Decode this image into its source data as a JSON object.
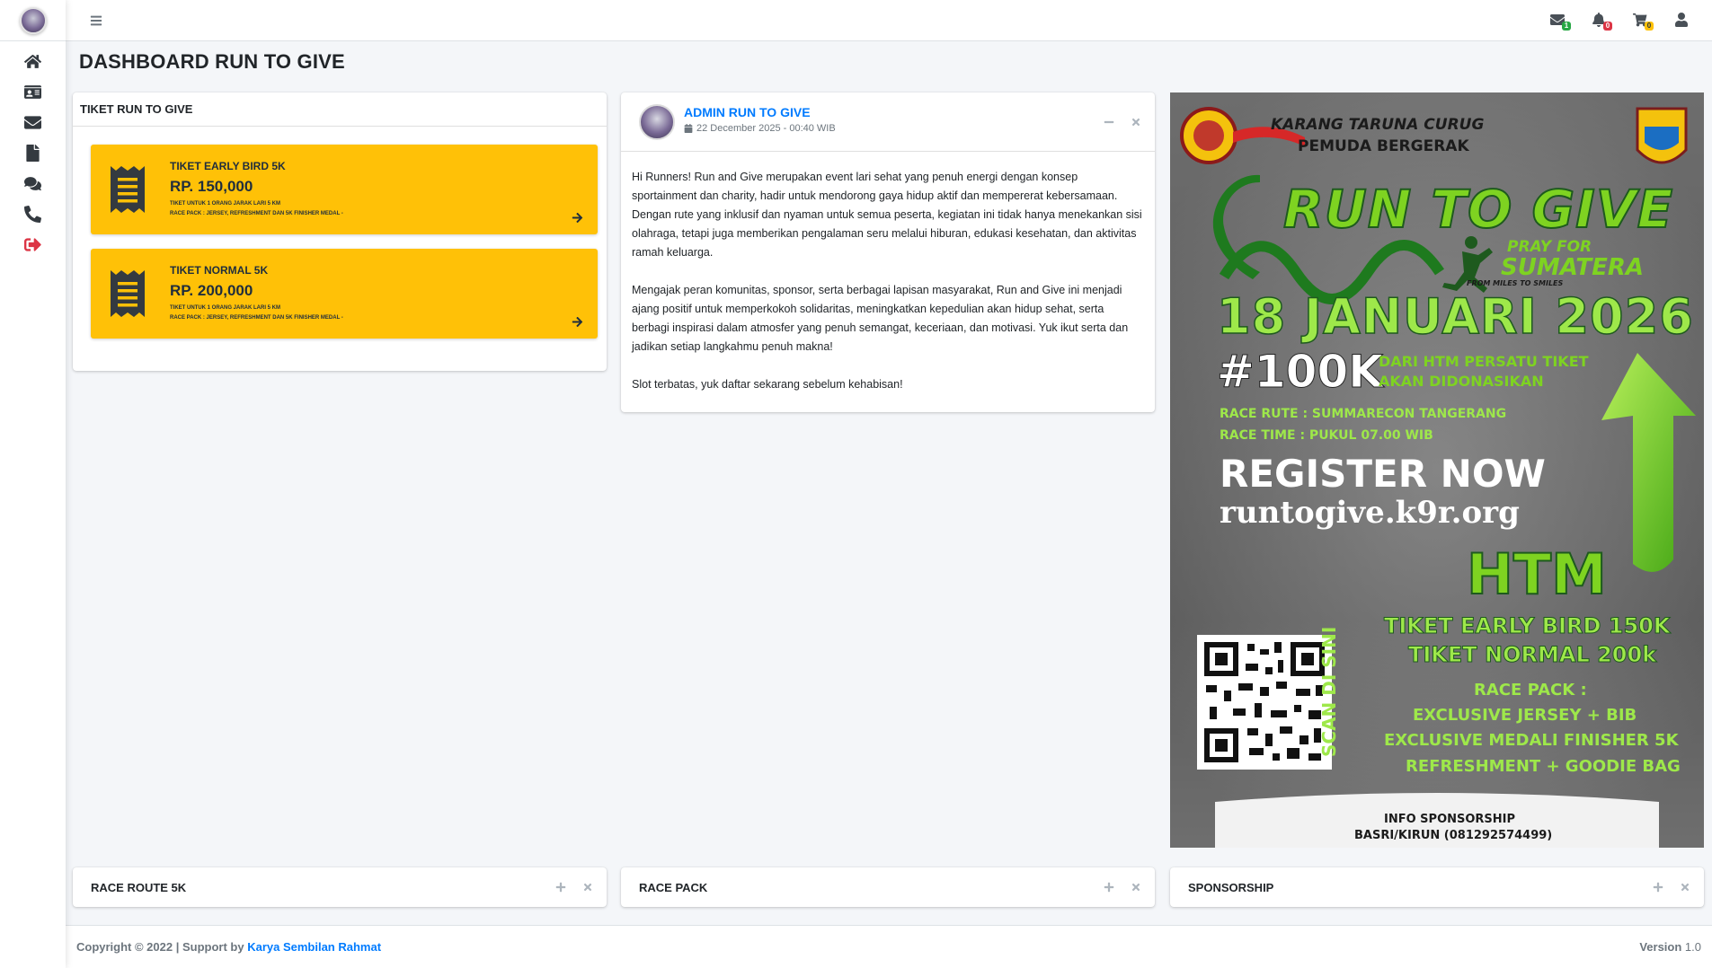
{
  "sidebar": {
    "items": [
      {
        "icon": "home-icon"
      },
      {
        "icon": "id-card-icon"
      },
      {
        "icon": "envelope-icon"
      },
      {
        "icon": "file-icon"
      },
      {
        "icon": "comments-icon"
      },
      {
        "icon": "phone-icon"
      },
      {
        "icon": "sign-out-icon"
      }
    ]
  },
  "topbar": {
    "messages_count": "1",
    "notifications_count": "0",
    "cart_count": "0"
  },
  "page": {
    "title": "DASHBOARD RUN TO GIVE"
  },
  "tickets_card": {
    "title": "TIKET RUN TO GIVE",
    "tickets": [
      {
        "name": "TIKET EARLY BIRD 5K",
        "price": "RP. 150,000",
        "desc1": "TIKET UNTUK 1 ORANG JARAK LARI 5 KM",
        "desc2": "RACE PACK : JERSEY, REFRESHMENT DAN 5K FINISHER MEDAL -"
      },
      {
        "name": "TIKET NORMAL 5K",
        "price": "RP. 200,000",
        "desc1": "TIKET UNTUK 1 ORANG JARAK LARI 5 KM",
        "desc2": "RACE PACK : JERSEY, REFRESHMENT DAN 5K FINISHER MEDAL -"
      }
    ]
  },
  "post": {
    "author": "ADMIN RUN TO GIVE",
    "date": "22 December 2025 - 00:40 WIB",
    "paragraphs": [
      "Hi Runners! Run and Give merupakan event lari sehat yang penuh energi dengan konsep sportainment dan charity, hadir untuk mendorong gaya hidup aktif dan mempererat kebersamaan. Dengan rute yang inklusif dan nyaman untuk semua peserta, kegiatan ini tidak hanya menekankan sisi olahraga, tetapi juga memberikan pengalaman seru melalui hiburan, edukasi kesehatan, dan aktivitas ramah keluarga.",
      "Mengajak peran komunitas, sponsor, serta berbagai lapisan masyarakat, Run and Give ini menjadi ajang positif untuk memperkokoh solidaritas, meningkatkan kepedulian akan hidup sehat, serta berbagi inspirasi dalam atmosfer yang penuh semangat, keceriaan, dan motivasi. Yuk ikut serta dan jadikan setiap langkahmu penuh makna!",
      "Slot terbatas, yuk daftar sekarang sebelum kehabisan!"
    ]
  },
  "poster": {
    "org1": "KARANG TARUNA CURUG",
    "org2": "PEMUDA BERGERAK",
    "event": "RUN TO GIVE",
    "pray": "PRAY FOR",
    "sumatera": "SUMATERA",
    "miles": "FROM MILES TO SMILES",
    "date": "18 JANUARI 2026",
    "donation": "#100K",
    "donation_note1": "DARI HTM PERSATU TIKET",
    "donation_note2": "AKAN DIDONASIKAN",
    "route": "RACE RUTE : SUMMARECON TANGERANG",
    "time": "RACE TIME : PUKUL 07.00 WIB",
    "register": "REGISTER NOW",
    "url": "runtogive.k9r.org",
    "htm": "HTM",
    "early": "TIKET EARLY BIRD 150K",
    "normal": "TIKET NORMAL 200k",
    "scan": "SCAN DI SINI",
    "racepack": "RACE PACK :",
    "rp1": "EXCLUSIVE JERSEY + BIB",
    "rp2": "EXCLUSIVE MEDALI FINISHER 5K",
    "rp3": "REFRESHMENT + GOODIE BAG",
    "info1": "INFO SPONSORSHIP",
    "info2": "BASRI/KIRUN (081292574499)"
  },
  "bottom_cards": [
    {
      "title": "RACE ROUTE 5K"
    },
    {
      "title": "RACE PACK"
    },
    {
      "title": "SPONSORSHIP"
    }
  ],
  "footer": {
    "copyright": "Copyright © 2022 | Support by",
    "link": "Karya Sembilan Rahmat",
    "version_label": "Version",
    "version": "1.0"
  }
}
